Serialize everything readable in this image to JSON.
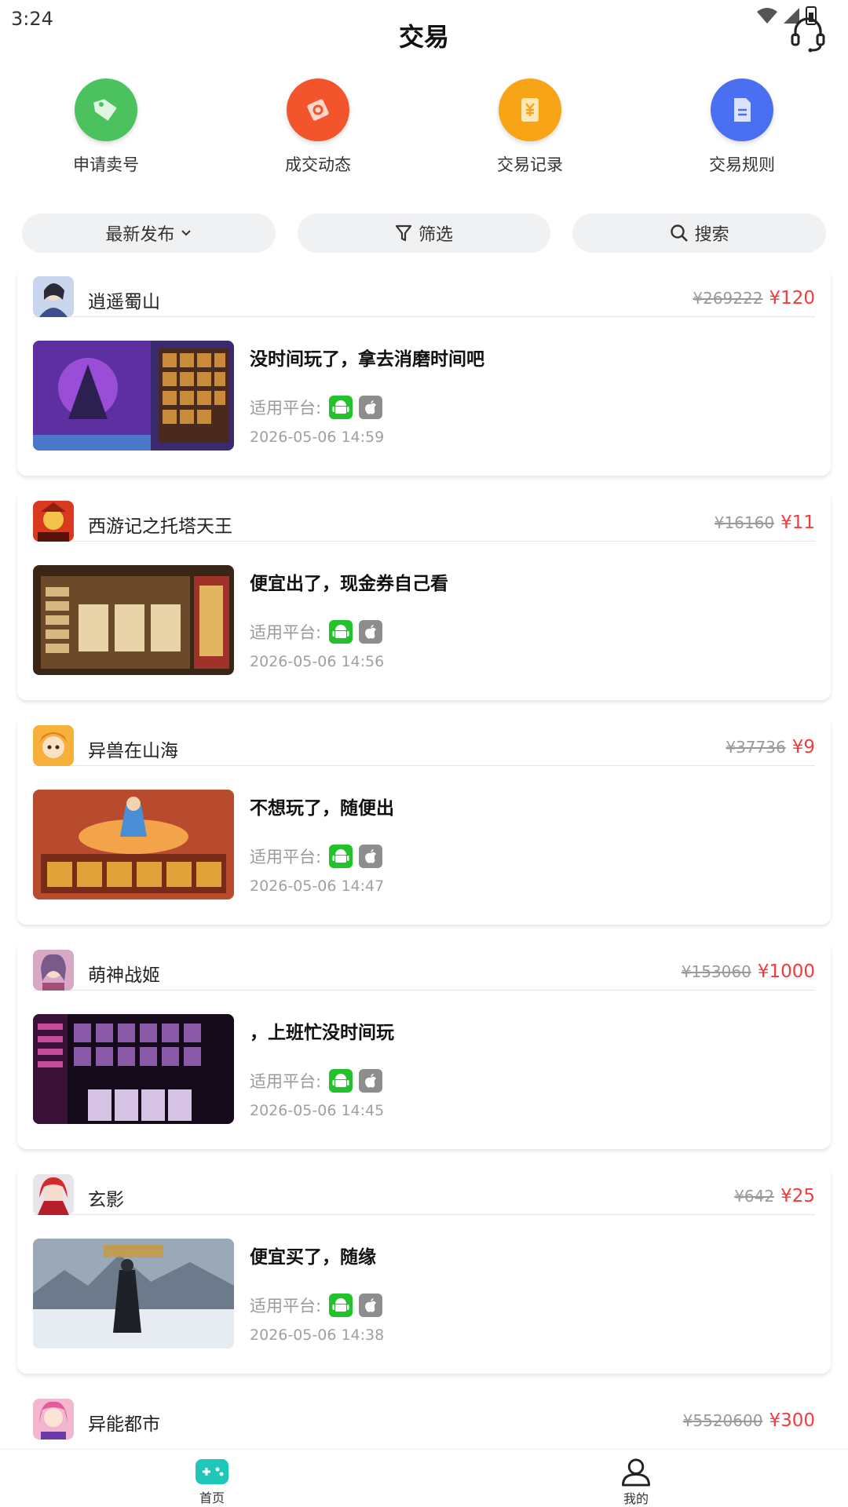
{
  "status_bar": {
    "time": "3:24"
  },
  "header": {
    "title": "交易"
  },
  "quick_actions": [
    {
      "label": "申请卖号",
      "icon": "tag-icon",
      "color": "#4cc25e"
    },
    {
      "label": "成交动态",
      "icon": "deal-icon",
      "color": "#f2552c"
    },
    {
      "label": "交易记录",
      "icon": "record-icon",
      "color": "#f7a517"
    },
    {
      "label": "交易规则",
      "icon": "rules-doc-icon",
      "color": "#4a6ff0"
    }
  ],
  "filters": {
    "sort_label": "最新发布",
    "filter_label": "筛选",
    "search_label": "搜索"
  },
  "listings": [
    {
      "game": "逍遥蜀山",
      "old_price": "¥269222",
      "price": "¥120",
      "title": "没时间玩了，拿去消磨时间吧",
      "platform_label": "适用平台:",
      "time": "2026-05-06 14:59"
    },
    {
      "game": "西游记之托塔天王",
      "old_price": "¥16160",
      "price": "¥11",
      "title": "便宜出了，现金券自己看",
      "platform_label": "适用平台:",
      "time": "2026-05-06 14:56"
    },
    {
      "game": "异兽在山海",
      "old_price": "¥37736",
      "price": "¥9",
      "title": "不想玩了，随便出",
      "platform_label": "适用平台:",
      "time": "2026-05-06 14:47"
    },
    {
      "game": "萌神战姬",
      "old_price": "¥153060",
      "price": "¥1000",
      "title": "，上班忙没时间玩",
      "platform_label": "适用平台:",
      "time": "2026-05-06 14:45"
    },
    {
      "game": "玄影",
      "old_price": "¥642",
      "price": "¥25",
      "title": "便宜买了，随缘",
      "platform_label": "适用平台:",
      "time": "2026-05-06 14:38"
    },
    {
      "game": "异能都市",
      "old_price": "¥5520600",
      "price": "¥300"
    }
  ],
  "bottom_nav": [
    {
      "label": "首页",
      "icon": "gamepad-icon",
      "active": true
    },
    {
      "label": "我的",
      "icon": "user-icon",
      "active": false
    }
  ],
  "colors": {
    "price_red": "#f23b3b",
    "android_green": "#22c22a",
    "ios_grey": "#8d8d8d",
    "nav_active": "#1fc7b8"
  }
}
